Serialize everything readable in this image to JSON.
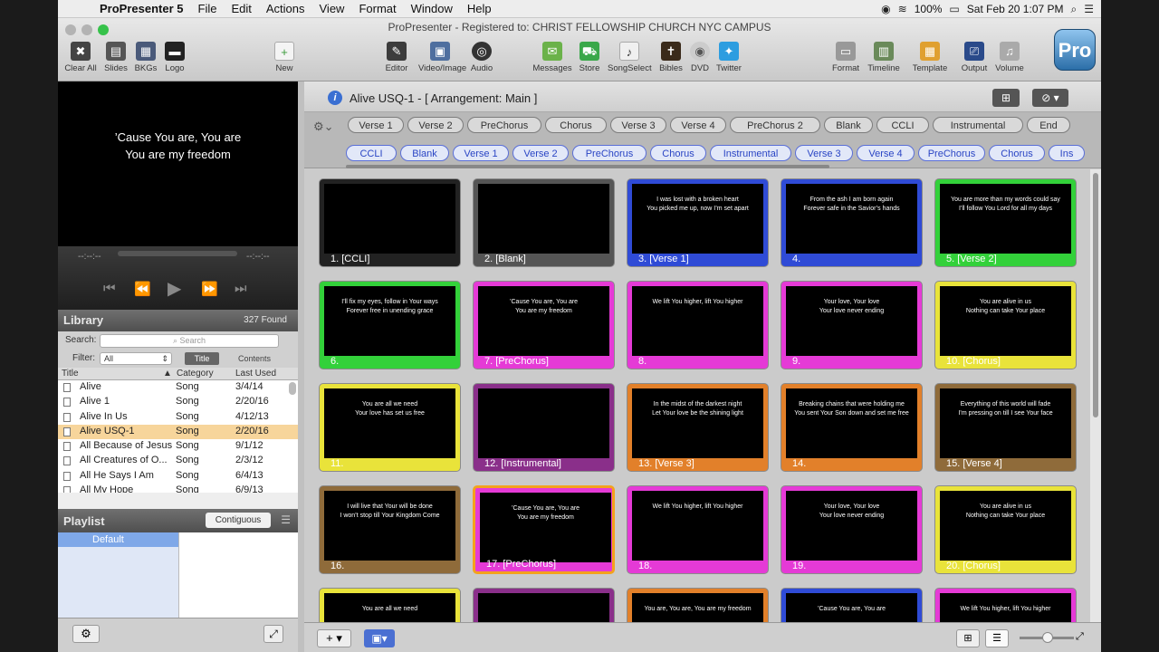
{
  "menubar": {
    "app": "ProPresenter 5",
    "items": [
      "File",
      "Edit",
      "Actions",
      "View",
      "Format",
      "Window",
      "Help"
    ],
    "battery": "100%",
    "clock": "Sat Feb 20  1:07 PM"
  },
  "window": {
    "title": "ProPresenter - Registered to: CHRIST FELLOWSHIP CHURCH NYC CAMPUS"
  },
  "toolbar": {
    "clear_all": "Clear All",
    "slides": "Slides",
    "bkgs": "BKGs",
    "logo": "Logo",
    "new": "New",
    "editor": "Editor",
    "video_image": "Video/Image",
    "audio": "Audio",
    "messages": "Messages",
    "store": "Store",
    "songselect": "SongSelect",
    "bibles": "Bibles",
    "dvd": "DVD",
    "twitter": "Twitter",
    "format": "Format",
    "timeline": "Timeline",
    "template": "Template",
    "output": "Output",
    "volume": "Volume",
    "pro": "Pro"
  },
  "preview": {
    "line1": "’Cause You are, You are",
    "line2": "You are my freedom",
    "time_left": "--:--:--",
    "time_right": "--:--:--"
  },
  "library": {
    "title": "Library",
    "found": "327 Found",
    "search_label": "Search:",
    "search_placeholder": "Search",
    "filter_label": "Filter:",
    "filter_value": "All",
    "tab_title": "Title",
    "tab_contents": "Contents",
    "col_title": "Title",
    "col_category": "Category",
    "col_last_used": "Last Used",
    "songs": [
      {
        "title": "Alive",
        "category": "Song",
        "last_used": "3/4/14"
      },
      {
        "title": "Alive 1",
        "category": "Song",
        "last_used": "2/20/16"
      },
      {
        "title": "Alive In Us",
        "category": "Song",
        "last_used": "4/12/13"
      },
      {
        "title": "Alive USQ-1",
        "category": "Song",
        "last_used": "2/20/16"
      },
      {
        "title": "All Because of Jesus",
        "category": "Song",
        "last_used": "9/1/12"
      },
      {
        "title": "All Creatures of O...",
        "category": "Song",
        "last_used": "2/3/12"
      },
      {
        "title": "All He Says I Am",
        "category": "Song",
        "last_used": "6/4/13"
      },
      {
        "title": "All My Hope",
        "category": "Song",
        "last_used": "6/9/13"
      }
    ]
  },
  "playlist": {
    "title": "Playlist",
    "mode": "Contiguous",
    "items": [
      "Default"
    ]
  },
  "document": {
    "title": "Alive USQ-1  - [ Arrangement: Main ]"
  },
  "groups_row": [
    "Verse 1",
    "Verse 2",
    "PreChorus",
    "Chorus",
    "Verse 3",
    "Verse 4",
    "PreChorus 2",
    "Blank",
    "CCLI",
    "Instrumental",
    "End"
  ],
  "arrangement_row": [
    "CCLI",
    "Blank",
    "Verse 1",
    "Verse 2",
    "PreChorus",
    "Chorus",
    "Instrumental",
    "Verse 3",
    "Verse 4",
    "PreChorus",
    "Chorus",
    "Ins"
  ],
  "colors": {
    "ccli": "#222222",
    "blank": "#555555",
    "verse1": "#2f4bd6",
    "verse2": "#33d13a",
    "prechorus": "#e53ad6",
    "chorus": "#e9e33a",
    "verse3": "#e2802a",
    "verse4": "#8f6b3a",
    "instrumental": "#8a2f8a",
    "selected_border": "#f3a21d"
  },
  "slides": [
    {
      "label": "1. [CCLI]",
      "text1": "",
      "text2": "",
      "color": "#222222"
    },
    {
      "label": "2. [Blank]",
      "text1": "",
      "text2": "",
      "color": "#555555"
    },
    {
      "label": "3. [Verse 1]",
      "text1": "I was lost with a broken heart",
      "text2": "You picked me up, now I’m set apart",
      "color": "#2f4bd6"
    },
    {
      "label": "4.",
      "text1": "From the ash I am born again",
      "text2": "Forever safe in the Savior’s hands",
      "color": "#2f4bd6"
    },
    {
      "label": "5. [Verse 2]",
      "text1": "You are more than my words could say",
      "text2": "I’ll follow You Lord for all my days",
      "color": "#33d13a"
    },
    {
      "label": "6.",
      "text1": "I’ll fix my eyes, follow in Your ways",
      "text2": "Forever free in unending grace",
      "color": "#33d13a"
    },
    {
      "label": "7. [PreChorus]",
      "text1": "’Cause You are, You are",
      "text2": "You are my freedom",
      "color": "#e53ad6"
    },
    {
      "label": "8.",
      "text1": "We lift You higher, lift You higher",
      "text2": "",
      "color": "#e53ad6"
    },
    {
      "label": "9.",
      "text1": "Your love, Your love",
      "text2": "Your love never ending",
      "color": "#e53ad6"
    },
    {
      "label": "10. [Chorus]",
      "text1": "You are alive in us",
      "text2": "Nothing can take Your place",
      "color": "#e9e33a"
    },
    {
      "label": "11.",
      "text1": "You are all we need",
      "text2": "Your love has set us free",
      "color": "#e9e33a"
    },
    {
      "label": "12. [Instrumental]",
      "text1": "",
      "text2": "",
      "color": "#8a2f8a"
    },
    {
      "label": "13. [Verse 3]",
      "text1": "In the midst of the darkest night",
      "text2": "Let Your love be the shining light",
      "color": "#e2802a"
    },
    {
      "label": "14.",
      "text1": "Breaking chains that were holding me",
      "text2": "You sent Your Son down and set me free",
      "color": "#e2802a"
    },
    {
      "label": "15. [Verse 4]",
      "text1": "Everything of this world will fade",
      "text2": "I’m pressing on till I see Your face",
      "color": "#8f6b3a"
    },
    {
      "label": "16.",
      "text1": "I will live that Your will be done",
      "text2": "I won’t stop till Your Kingdom Come",
      "color": "#8f6b3a"
    },
    {
      "label": "17. [PreChorus]",
      "text1": "’Cause You are, You are",
      "text2": "You are my freedom",
      "color": "#e53ad6"
    },
    {
      "label": "18.",
      "text1": "We lift You higher, lift You higher",
      "text2": "",
      "color": "#e53ad6"
    },
    {
      "label": "19.",
      "text1": "Your love, Your love",
      "text2": "Your love never ending",
      "color": "#e53ad6"
    },
    {
      "label": "20. [Chorus]",
      "text1": "You are alive in us",
      "text2": "Nothing can take Your place",
      "color": "#e9e33a"
    },
    {
      "label": "",
      "text1": "You are all we need",
      "text2": "",
      "color": "#e9e33a"
    },
    {
      "label": "",
      "text1": "",
      "text2": "",
      "color": "#8a2f8a"
    },
    {
      "label": "",
      "text1": "You are, You are, You are my freedom",
      "text2": "",
      "color": "#e2802a"
    },
    {
      "label": "",
      "text1": "’Cause You are, You are",
      "text2": "",
      "color": "#2f4bd6"
    },
    {
      "label": "",
      "text1": "We lift You higher, lift You higher",
      "text2": "",
      "color": "#e53ad6"
    }
  ]
}
